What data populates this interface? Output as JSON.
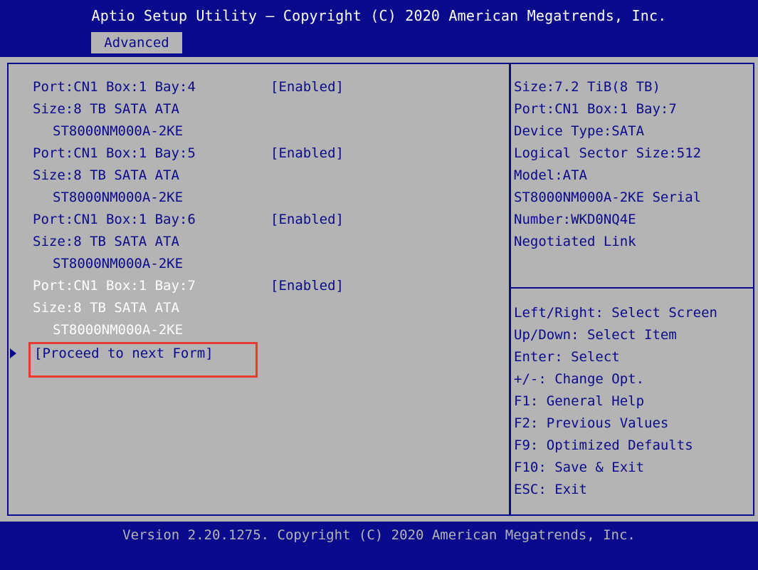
{
  "header": {
    "title": "Aptio Setup Utility – Copyright (C) 2020 American Megatrends, Inc.",
    "active_tab": "Advanced"
  },
  "ports": [
    {
      "port": "Port:CN1 Box:1 Bay:4",
      "value": "[Enabled]",
      "size": "Size:8 TB SATA ATA",
      "model": "ST8000NM000A-2KE"
    },
    {
      "port": "Port:CN1 Box:1 Bay:5",
      "value": "[Enabled]",
      "size": "Size:8 TB SATA ATA",
      "model": "ST8000NM000A-2KE"
    },
    {
      "port": "Port:CN1 Box:1 Bay:6",
      "value": "[Enabled]",
      "size": "Size:8 TB SATA ATA",
      "model": "ST8000NM000A-2KE"
    },
    {
      "port": "Port:CN1 Box:1 Bay:7",
      "value": "[Enabled]",
      "size": "Size:8 TB SATA ATA",
      "model": "ST8000NM000A-2KE"
    }
  ],
  "proceed_link": "[Proceed to next Form]",
  "device_info": [
    "Size:7.2 TiB(8 TB)",
    "Port:CN1 Box:1 Bay:7",
    "Device Type:SATA",
    "Logical Sector Size:512",
    "Model:ATA",
    "ST8000NM000A-2KE Serial",
    "Number:WKD0NQ4E",
    "Negotiated Link"
  ],
  "help_keys": [
    "Left/Right: Select Screen",
    "Up/Down: Select Item",
    "Enter: Select",
    "+/-: Change Opt.",
    "F1: General Help",
    "F2: Previous Values",
    "F9: Optimized Defaults",
    "F10: Save & Exit",
    "ESC: Exit"
  ],
  "footer": {
    "version": "Version 2.20.1275. Copyright (C) 2020 American Megatrends, Inc."
  },
  "colors": {
    "bios_blue": "#0a0a8c",
    "bios_gray": "#b4b4b4",
    "highlight_red": "#e53b33"
  }
}
